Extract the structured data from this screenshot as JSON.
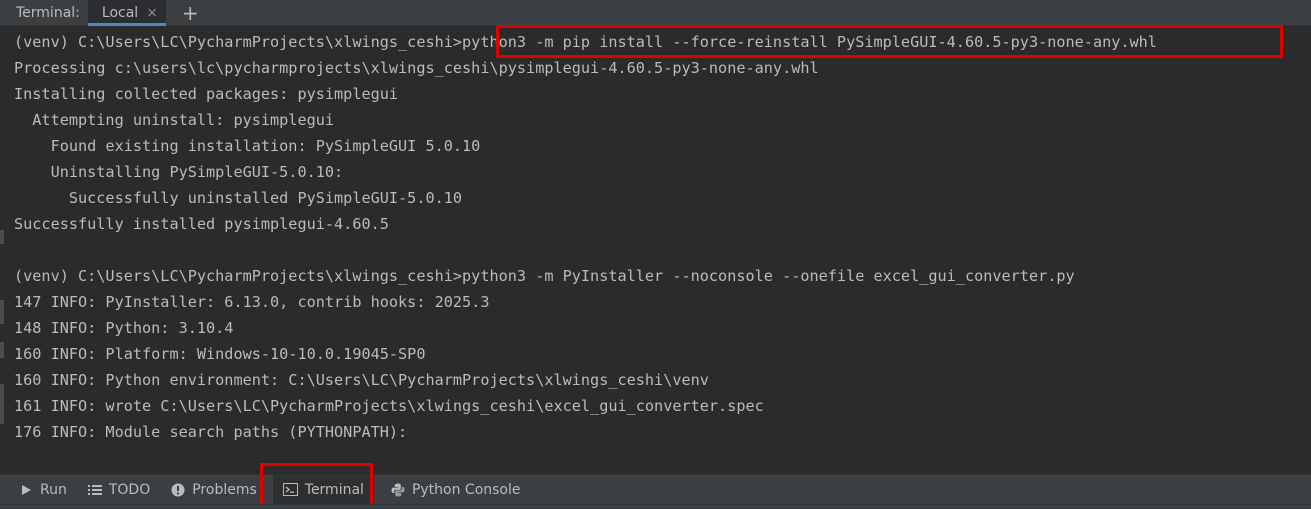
{
  "header": {
    "panel_title": "Terminal:",
    "tab_label": "Local",
    "close_glyph": "×",
    "new_tab_glyph": "+"
  },
  "terminal": {
    "lines": [
      "(venv) C:\\Users\\LC\\PycharmProjects\\xlwings_ceshi>python3 -m pip install --force-reinstall PySimpleGUI-4.60.5-py3-none-any.whl",
      "Processing c:\\users\\lc\\pycharmprojects\\xlwings_ceshi\\pysimplegui-4.60.5-py3-none-any.whl",
      "Installing collected packages: pysimplegui",
      "  Attempting uninstall: pysimplegui",
      "    Found existing installation: PySimpleGUI 5.0.10",
      "    Uninstalling PySimpleGUI-5.0.10:",
      "      Successfully uninstalled PySimpleGUI-5.0.10",
      "Successfully installed pysimplegui-4.60.5",
      "",
      "(venv) C:\\Users\\LC\\PycharmProjects\\xlwings_ceshi>python3 -m PyInstaller --noconsole --onefile excel_gui_converter.py",
      "147 INFO: PyInstaller: 6.13.0, contrib hooks: 2025.3",
      "148 INFO: Python: 3.10.4",
      "160 INFO: Platform: Windows-10-10.0.19045-SP0",
      "160 INFO: Python environment: C:\\Users\\LC\\PycharmProjects\\xlwings_ceshi\\venv",
      "161 INFO: wrote C:\\Users\\LC\\PycharmProjects\\xlwings_ceshi\\excel_gui_converter.spec",
      "176 INFO: Module search paths (PYTHONPATH):"
    ]
  },
  "toolbar": {
    "run": "Run",
    "todo": "TODO",
    "problems": "Problems",
    "terminal": "Terminal",
    "python_console": "Python Console"
  },
  "colors": {
    "background": "#2b2b2b",
    "panel": "#3c3f41",
    "text": "#bbbbbb",
    "highlight": "#e00000",
    "tab_accent": "#4a88c7"
  },
  "icons": {
    "run": "play-icon",
    "todo": "list-icon",
    "problems": "info-icon",
    "terminal": "terminal-icon",
    "python_console": "python-icon"
  }
}
